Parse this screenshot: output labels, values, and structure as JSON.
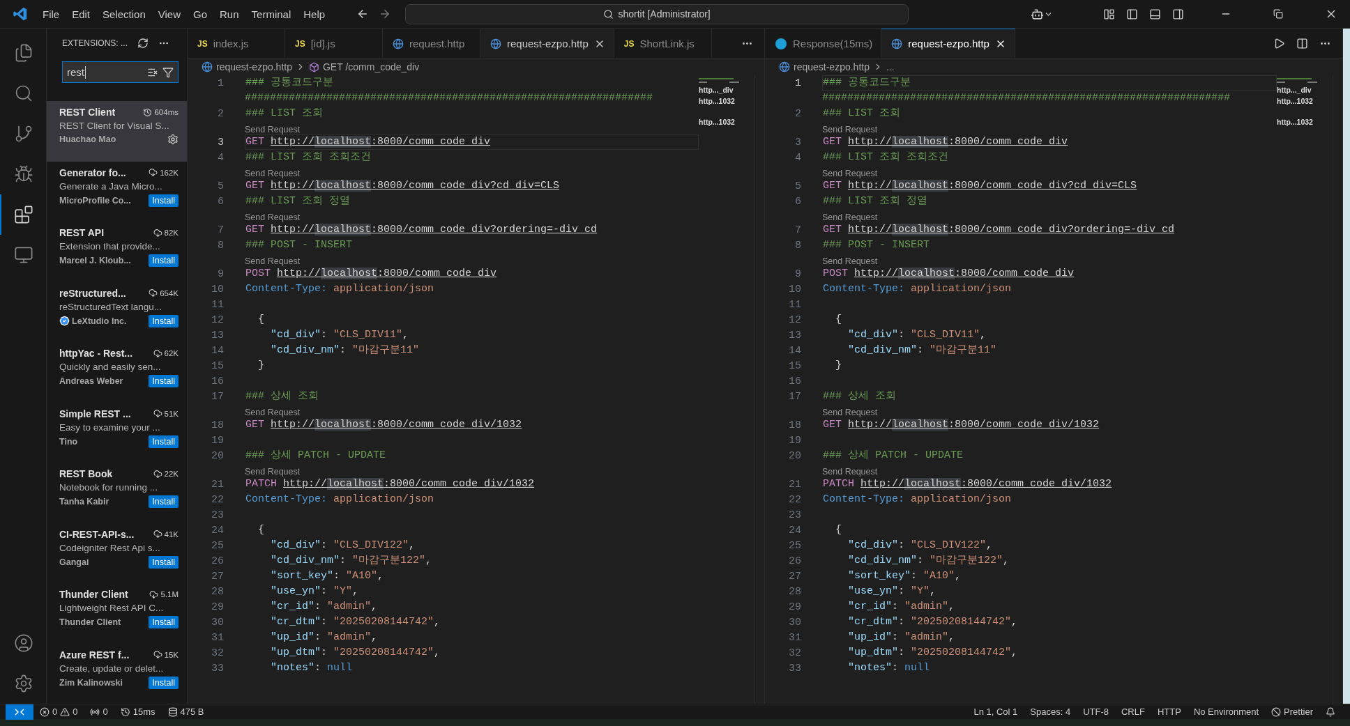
{
  "menu": [
    "File",
    "Edit",
    "Selection",
    "View",
    "Go",
    "Run",
    "Terminal",
    "Help"
  ],
  "command_center": "shortit [Administrator]",
  "activity_bar": [
    {
      "kind": "explorer",
      "selected": false
    },
    {
      "kind": "search",
      "selected": false
    },
    {
      "kind": "source_control",
      "selected": false
    },
    {
      "kind": "run_debug",
      "selected": false
    },
    {
      "kind": "extensions",
      "selected": true
    },
    {
      "kind": "remote",
      "selected": false
    }
  ],
  "activity_bottom": [
    {
      "kind": "account"
    },
    {
      "kind": "settings"
    }
  ],
  "sidebar": {
    "title": "EXTENSIONS: ...",
    "search": {
      "value": "rest"
    },
    "items": [
      {
        "kind": "installed",
        "name": "REST Client",
        "stat": "604ms",
        "description": "REST Client for Visual S...",
        "publisher": "Huachao Mao",
        "verified": false,
        "selected": true
      },
      {
        "kind": "marketplace",
        "name": "Generator fo...",
        "stat": "162K",
        "description": "Generate a Java Micro...",
        "publisher": "MicroProfile Co...",
        "verified": false,
        "action": "Install",
        "selected": false
      },
      {
        "kind": "marketplace",
        "name": "REST API",
        "stat": "82K",
        "description": "Extension that provide...",
        "publisher": "Marcel J. Kloub...",
        "verified": false,
        "action": "Install",
        "selected": false
      },
      {
        "kind": "marketplace",
        "name": "reStructured...",
        "stat": "654K",
        "description": "reStructuredText langu...",
        "publisher": "LeXtudio Inc.",
        "verified": true,
        "action": "Install",
        "selected": false
      },
      {
        "kind": "marketplace",
        "name": "httpYac - Rest...",
        "stat": "62K",
        "description": "Quickly and easily sen...",
        "publisher": "Andreas Weber",
        "verified": false,
        "action": "Install",
        "selected": false
      },
      {
        "kind": "marketplace",
        "name": "Simple REST ...",
        "stat": "51K",
        "description": "Easy to examine your ...",
        "publisher": "Tino",
        "verified": false,
        "action": "Install",
        "selected": false
      },
      {
        "kind": "marketplace",
        "name": "REST Book",
        "stat": "22K",
        "description": "Notebook for running ...",
        "publisher": "Tanha Kabir",
        "verified": false,
        "action": "Install",
        "selected": false
      },
      {
        "kind": "marketplace",
        "name": "CI-REST-API-s...",
        "stat": "41K",
        "description": "Codeigniter Rest Api s...",
        "publisher": "Gangai",
        "verified": false,
        "action": "Install",
        "selected": false
      },
      {
        "kind": "marketplace",
        "name": "Thunder Client",
        "stat": "5.1M",
        "description": "Lightweight Rest API C...",
        "publisher": "Thunder Client",
        "verified": false,
        "action": "Install",
        "selected": false
      },
      {
        "kind": "marketplace",
        "name": "Azure REST f...",
        "stat": "15K",
        "description": "Create, update or delet...",
        "publisher": "Zim Kalinowski",
        "verified": false,
        "action": "Install",
        "selected": false
      }
    ]
  },
  "panes": [
    {
      "run_actions": false,
      "focused": false,
      "tabs": [
        {
          "kind": "js",
          "badge": "JS",
          "label": "index.js",
          "selected": false
        },
        {
          "kind": "js",
          "badge": "JS",
          "label": "[id].js",
          "selected": false
        },
        {
          "kind": "http",
          "label": "request.http",
          "selected": false
        },
        {
          "kind": "http",
          "label": "request-ezpo.http",
          "selected": true
        },
        {
          "kind": "js",
          "badge": "JS",
          "label": "ShortLink.js",
          "selected": false
        }
      ],
      "breadcrumb": [
        {
          "kind": "file",
          "text": "request-ezpo.http"
        },
        {
          "kind": "symbol",
          "text": "GET /comm_code_div"
        }
      ],
      "minimap_labels": [
        "http..._div",
        "http...1032",
        "http...1032"
      ],
      "lines": [
        {
          "n": "1",
          "current": false,
          "kind": "comment",
          "text": "### 공통코드구분",
          "wrapped": "#################################################################"
        },
        {
          "n": "2",
          "current": false,
          "kind": "comment",
          "text": "### LIST 조회"
        },
        {
          "n": "3",
          "current": true,
          "kind": "request",
          "lens": "Send Request",
          "text": "GET http://localhost:8000/comm_code_div"
        },
        {
          "n": "4",
          "current": false,
          "kind": "comment",
          "text": "### LIST 조회 조회조건"
        },
        {
          "n": "5",
          "current": false,
          "kind": "request",
          "lens": "Send Request",
          "text": "GET http://localhost:8000/comm_code_div?cd_div=CLS"
        },
        {
          "n": "6",
          "current": false,
          "kind": "comment",
          "text": "### LIST 조회 정열"
        },
        {
          "n": "7",
          "current": false,
          "kind": "request",
          "lens": "Send Request",
          "text": "GET http://localhost:8000/comm_code_div?ordering=-div_cd"
        },
        {
          "n": "8",
          "current": false,
          "kind": "comment",
          "text": "### POST - INSERT"
        },
        {
          "n": "9",
          "current": false,
          "kind": "request",
          "lens": "Send Request",
          "text": "POST http://localhost:8000/comm_code_div"
        },
        {
          "n": "10",
          "current": false,
          "kind": "header",
          "text": "Content-Type: application/json"
        },
        {
          "n": "11",
          "current": false,
          "kind": "blank"
        },
        {
          "n": "12",
          "current": false,
          "kind": "plain",
          "text": "  {"
        },
        {
          "n": "13",
          "current": false,
          "kind": "json",
          "text": "    \"cd_div\": \"CLS_DIV11\","
        },
        {
          "n": "14",
          "current": false,
          "kind": "json",
          "text": "    \"cd_div_nm\": \"마감구분11\""
        },
        {
          "n": "15",
          "current": false,
          "kind": "plain",
          "text": "  }"
        },
        {
          "n": "16",
          "current": false,
          "kind": "blank"
        },
        {
          "n": "17",
          "current": false,
          "kind": "comment",
          "text": "### 상세 조회"
        },
        {
          "n": "18",
          "current": false,
          "kind": "request",
          "lens": "Send Request",
          "text": "GET http://localhost:8000/comm_code_div/1032"
        },
        {
          "n": "19",
          "current": false,
          "kind": "blank"
        },
        {
          "n": "20",
          "current": false,
          "kind": "comment",
          "text": "### 상세 PATCH - UPDATE"
        },
        {
          "n": "21",
          "current": false,
          "kind": "request",
          "lens": "Send Request",
          "text": "PATCH http://localhost:8000/comm_code_div/1032"
        },
        {
          "n": "22",
          "current": false,
          "kind": "header",
          "text": "Content-Type: application/json"
        },
        {
          "n": "23",
          "current": false,
          "kind": "blank"
        },
        {
          "n": "24",
          "current": false,
          "kind": "plain",
          "text": "  {"
        },
        {
          "n": "25",
          "current": false,
          "kind": "json",
          "text": "    \"cd_div\": \"CLS_DIV122\","
        },
        {
          "n": "26",
          "current": false,
          "kind": "json",
          "text": "    \"cd_div_nm\": \"마감구분122\","
        },
        {
          "n": "27",
          "current": false,
          "kind": "json",
          "text": "    \"sort_key\": \"A10\","
        },
        {
          "n": "28",
          "current": false,
          "kind": "json",
          "text": "    \"use_yn\": \"Y\","
        },
        {
          "n": "29",
          "current": false,
          "kind": "json",
          "text": "    \"cr_id\": \"admin\","
        },
        {
          "n": "30",
          "current": false,
          "kind": "json",
          "text": "    \"cr_dtm\": \"20250208144742\","
        },
        {
          "n": "31",
          "current": false,
          "kind": "json",
          "text": "    \"up_id\": \"admin\","
        },
        {
          "n": "32",
          "current": false,
          "kind": "json",
          "text": "    \"up_dtm\": \"20250208144742\","
        },
        {
          "n": "33",
          "current": false,
          "kind": "json",
          "text": "    \"notes\": null"
        }
      ]
    },
    {
      "run_actions": true,
      "focused": true,
      "tabs": [
        {
          "kind": "response",
          "label": "Response(15ms)",
          "selected": false
        },
        {
          "kind": "http",
          "label": "request-ezpo.http",
          "selected": true
        }
      ],
      "breadcrumb": [
        {
          "kind": "file",
          "text": "request-ezpo.http"
        },
        {
          "kind": "more",
          "text": "..."
        }
      ],
      "minimap_labels": [
        "http..._div",
        "http...1032",
        "http...1032"
      ],
      "lines": [
        {
          "n": "1",
          "current": true,
          "kind": "comment",
          "text": "### 공통코드구분",
          "wrapped": "#################################################################"
        },
        {
          "n": "2",
          "current": false,
          "kind": "comment",
          "text": "### LIST 조회"
        },
        {
          "n": "3",
          "current": false,
          "kind": "request",
          "lens": "Send Request",
          "text": "GET http://localhost:8000/comm_code_div"
        },
        {
          "n": "4",
          "current": false,
          "kind": "comment",
          "text": "### LIST 조회 조회조건"
        },
        {
          "n": "5",
          "current": false,
          "kind": "request",
          "lens": "Send Request",
          "text": "GET http://localhost:8000/comm_code_div?cd_div=CLS"
        },
        {
          "n": "6",
          "current": false,
          "kind": "comment",
          "text": "### LIST 조회 정열"
        },
        {
          "n": "7",
          "current": false,
          "kind": "request",
          "lens": "Send Request",
          "text": "GET http://localhost:8000/comm_code_div?ordering=-div_cd"
        },
        {
          "n": "8",
          "current": false,
          "kind": "comment",
          "text": "### POST - INSERT"
        },
        {
          "n": "9",
          "current": false,
          "kind": "request",
          "lens": "Send Request",
          "text": "POST http://localhost:8000/comm_code_div"
        },
        {
          "n": "10",
          "current": false,
          "kind": "header",
          "text": "Content-Type: application/json"
        },
        {
          "n": "11",
          "current": false,
          "kind": "blank"
        },
        {
          "n": "12",
          "current": false,
          "kind": "plain",
          "text": "  {"
        },
        {
          "n": "13",
          "current": false,
          "kind": "json",
          "text": "    \"cd_div\": \"CLS_DIV11\","
        },
        {
          "n": "14",
          "current": false,
          "kind": "json",
          "text": "    \"cd_div_nm\": \"마감구분11\""
        },
        {
          "n": "15",
          "current": false,
          "kind": "plain",
          "text": "  }"
        },
        {
          "n": "16",
          "current": false,
          "kind": "blank"
        },
        {
          "n": "17",
          "current": false,
          "kind": "comment",
          "text": "### 상세 조회"
        },
        {
          "n": "18",
          "current": false,
          "kind": "request",
          "lens": "Send Request",
          "text": "GET http://localhost:8000/comm_code_div/1032"
        },
        {
          "n": "19",
          "current": false,
          "kind": "blank"
        },
        {
          "n": "20",
          "current": false,
          "kind": "comment",
          "text": "### 상세 PATCH - UPDATE"
        },
        {
          "n": "21",
          "current": false,
          "kind": "request",
          "lens": "Send Request",
          "text": "PATCH http://localhost:8000/comm_code_div/1032"
        },
        {
          "n": "22",
          "current": false,
          "kind": "header",
          "text": "Content-Type: application/json"
        },
        {
          "n": "23",
          "current": false,
          "kind": "blank"
        },
        {
          "n": "24",
          "current": false,
          "kind": "plain",
          "text": "  {"
        },
        {
          "n": "25",
          "current": false,
          "kind": "json",
          "text": "    \"cd_div\": \"CLS_DIV122\","
        },
        {
          "n": "26",
          "current": false,
          "kind": "json",
          "text": "    \"cd_div_nm\": \"마감구분122\","
        },
        {
          "n": "27",
          "current": false,
          "kind": "json",
          "text": "    \"sort_key\": \"A10\","
        },
        {
          "n": "28",
          "current": false,
          "kind": "json",
          "text": "    \"use_yn\": \"Y\","
        },
        {
          "n": "29",
          "current": false,
          "kind": "json",
          "text": "    \"cr_id\": \"admin\","
        },
        {
          "n": "30",
          "current": false,
          "kind": "json",
          "text": "    \"cr_dtm\": \"20250208144742\","
        },
        {
          "n": "31",
          "current": false,
          "kind": "json",
          "text": "    \"up_id\": \"admin\","
        },
        {
          "n": "32",
          "current": false,
          "kind": "json",
          "text": "    \"up_dtm\": \"20250208144742\","
        },
        {
          "n": "33",
          "current": false,
          "kind": "json",
          "text": "    \"notes\": null"
        }
      ]
    }
  ],
  "status_left": [
    {
      "kind": "remote"
    },
    {
      "kind": "problems",
      "errors": "0",
      "warnings": "0"
    },
    {
      "kind": "ports",
      "text": "0"
    },
    {
      "kind": "time",
      "text": "15ms"
    },
    {
      "kind": "size",
      "text": "475 B"
    }
  ],
  "status_right": [
    {
      "kind": "text",
      "text": "Ln 1, Col 1"
    },
    {
      "kind": "text",
      "text": "Spaces: 4"
    },
    {
      "kind": "text",
      "text": "UTF-8"
    },
    {
      "kind": "text",
      "text": "CRLF"
    },
    {
      "kind": "text",
      "text": "HTTP"
    },
    {
      "kind": "text",
      "text": "No Environment"
    },
    {
      "kind": "prettier",
      "text": "Prettier"
    },
    {
      "kind": "bell"
    }
  ]
}
